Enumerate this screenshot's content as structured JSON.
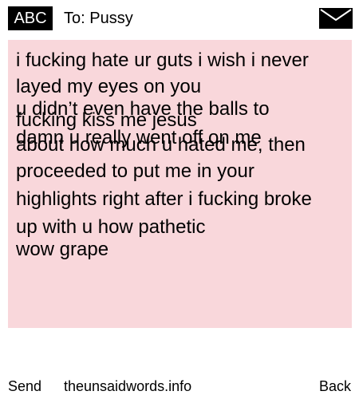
{
  "header": {
    "mode_label": "ABC",
    "recipient": "To: Pussy",
    "icon": "envelope-icon"
  },
  "message": {
    "lines": [
      "i fucking hate ur guts i wish i never",
      "layed my eyes on you",
      "u didn’t even have the balls to",
      "fucking kiss me jesus",
      "damn u really went off on me",
      "about how much u hated me, then",
      "proceeded to put me in your",
      "highlights right after i fucking broke",
      "up with u how pathetic",
      "wow grape"
    ]
  },
  "footer": {
    "send_label": "Send",
    "site_label": "theunsaidwords.info",
    "back_label": "Back"
  },
  "colors": {
    "message_background": "#f9d7db",
    "badge_background": "#000000",
    "text": "#000000"
  }
}
